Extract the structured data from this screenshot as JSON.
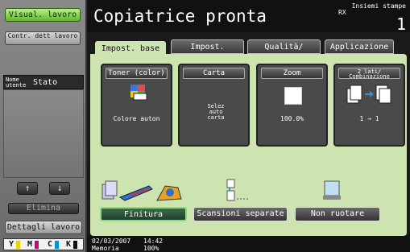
{
  "left": {
    "visual_lavoro": "Visual. lavoro",
    "controllo_dett": "Contr. dett lavoro",
    "nome_utente": "Nome utente",
    "stato": "Stato",
    "elimina": "Elimina",
    "dettagli_lavoro": "Dettagli lavoro",
    "toner_letters": [
      "Y",
      "M",
      "C",
      "K"
    ],
    "toner_colors": [
      "#e6d400",
      "#d4007a",
      "#0096d6",
      "#111111"
    ]
  },
  "header": {
    "title": "Copiatrice pronta",
    "label_top": "Insiemi stampe",
    "label_rx": "RX",
    "counter": "1"
  },
  "tabs": [
    {
      "label": "Impost. base",
      "active": true
    },
    {
      "label": "Impost. Standard",
      "active": false
    },
    {
      "label": "Qualità/ Densità",
      "active": false
    },
    {
      "label": "Applicazione",
      "active": false
    }
  ],
  "cards": [
    {
      "head": "Toner (color)",
      "value": "Colore auton"
    },
    {
      "head": "Carta",
      "value": "Selez auto carta"
    },
    {
      "head": "Zoom",
      "value": "100.0%"
    },
    {
      "head": "2 lati/ Combinazione",
      "value": "1 → 1"
    }
  ],
  "options": {
    "finitura": "Finitura",
    "scansioni": "Scansioni separate",
    "non_ruotare": "Non ruotare"
  },
  "footer": {
    "date": "02/03/2007",
    "time": "14:42",
    "memory_label": "Memoria",
    "memory_value": "100%"
  },
  "colors": {
    "accent_green": "#5fb92c",
    "panel": "#cde3b0"
  }
}
